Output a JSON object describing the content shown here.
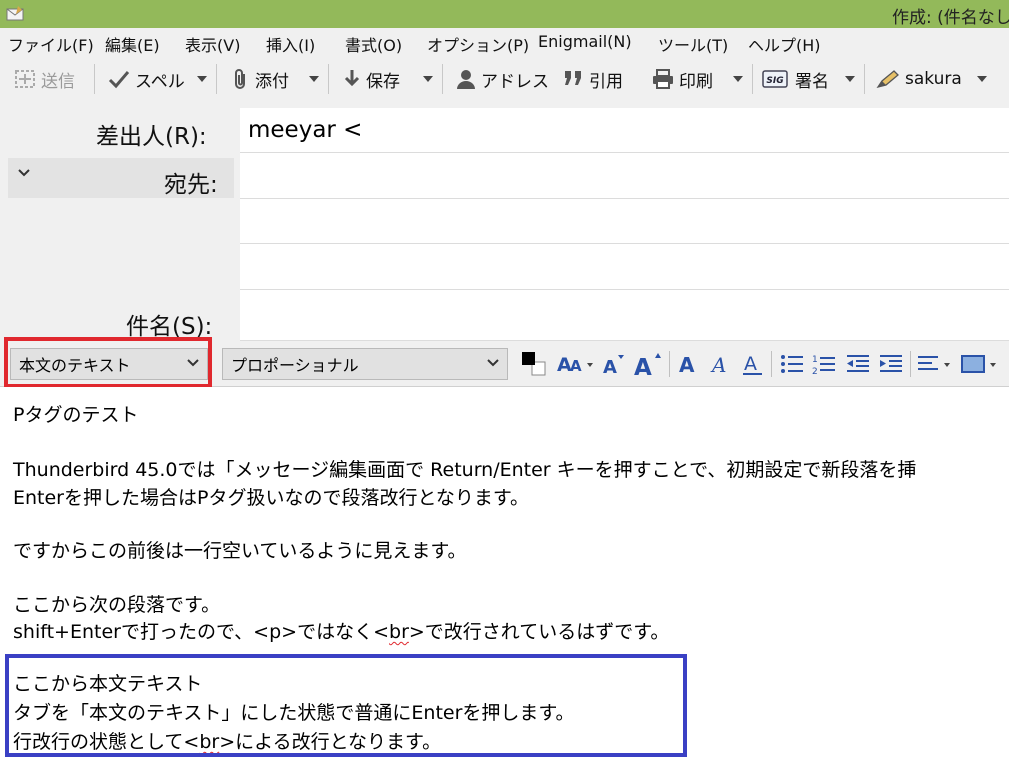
{
  "window": {
    "title": "作成: (件名なし"
  },
  "menu": {
    "file": "ファイル(F)",
    "edit": "編集(E)",
    "view": "表示(V)",
    "insert": "挿入(I)",
    "format": "書式(O)",
    "options": "オプション(P)",
    "enigmail": "Enigmail(N)",
    "tools": "ツール(T)",
    "help": "ヘルプ(H)"
  },
  "toolbar": {
    "send": "送信",
    "spell": "スペル",
    "attach": "添付",
    "save": "保存",
    "address": "アドレス",
    "quote": "引用",
    "print": "印刷",
    "signature": "署名",
    "sakura": "sakura"
  },
  "header": {
    "from_label": "差出人(R):",
    "from_value": "meeyar <",
    "to_label": "宛先:",
    "subject_label": "件名(S):",
    "subject_value": ""
  },
  "format_bar": {
    "paragraph_format": "本文のテキスト",
    "font": "プロポーショナル"
  },
  "colors": {
    "titlebar": "#93b95a",
    "highlight_red": "#e0282e",
    "highlight_blue": "#3a40c4",
    "icon_blue": "#2a52a8"
  },
  "body": {
    "l1": "Pタグのテスト",
    "l2": "Thunderbird 45.0では「メッセージ編集画面で Return/Enter キーを押すことで、初期設定で新段落を挿",
    "l3": "Enterを押した場合はPタグ扱いなので段落改行となります。",
    "l4": "ですからこの前後は一行空いているように見えます。",
    "l5": "ここから次の段落です。",
    "l6a": "shift+Enterで打ったので、<p>ではなく<",
    "l6b": "br",
    "l6c": ">で改行されているはずです。",
    "l7": "ここから本文テキスト",
    "l8": "タブを「本文のテキスト」にした状態で普通にEnterを押します。",
    "l9a": "行改行の状態として<",
    "l9b": "br",
    "l9c": ">による改行となります。"
  }
}
